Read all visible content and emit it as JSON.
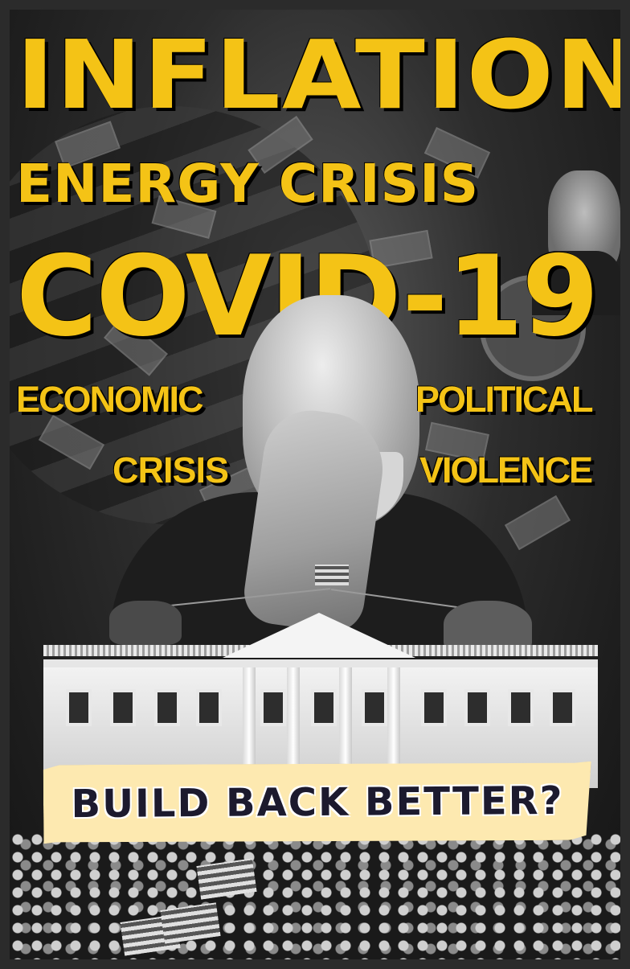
{
  "poster": {
    "headline_1": "INFLATION",
    "headline_2": "ENERGY CRISIS",
    "headline_3": "COVID-19",
    "left_label_line1": "ECONOMIC",
    "left_label_line2": "CRISIS",
    "right_label_line1": "POLITICAL",
    "right_label_line2": "VIOLENCE",
    "banner_text": "BUILD BACK BETTER?"
  },
  "colors": {
    "headline": "#f4c316",
    "banner_bg": "#fde9b0",
    "banner_text": "#1c1a2e",
    "frame": "#2b2b2b"
  }
}
